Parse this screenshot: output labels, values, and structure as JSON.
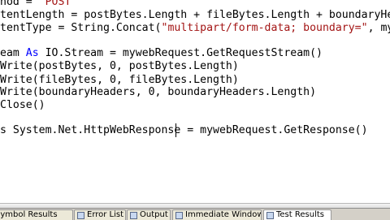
{
  "editor": {
    "lines": [
      [
        {
          "t": "hod = ",
          "c": "txt"
        },
        {
          "t": "\"POST\"",
          "c": "str"
        }
      ],
      [
        {
          "t": "tentLength = postBytes.Length + fileBytes.Length + boundaryHeaders.Le",
          "c": "txt"
        }
      ],
      [
        {
          "t": "tentType = String.Concat(",
          "c": "txt"
        },
        {
          "t": "\"multipart/form-data; boundary=\"",
          "c": "str"
        },
        {
          "t": ", myboundary",
          "c": "txt"
        }
      ],
      [
        {
          "t": "",
          "c": "txt"
        }
      ],
      [
        {
          "t": "eam ",
          "c": "txt"
        },
        {
          "t": "As",
          "c": "kw"
        },
        {
          "t": " IO.Stream = mywebRequest.GetRequestStream()",
          "c": "txt"
        }
      ],
      [
        {
          "t": "Write(postBytes, 0, postBytes.Length)",
          "c": "txt"
        }
      ],
      [
        {
          "t": "Write(fileBytes, 0, fileBytes.Length)",
          "c": "txt"
        }
      ],
      [
        {
          "t": "Write(boundaryHeaders, 0, boundaryHeaders.Length)",
          "c": "txt"
        }
      ],
      [
        {
          "t": "Close()",
          "c": "txt"
        }
      ],
      [
        {
          "t": "",
          "c": "txt"
        }
      ],
      [
        {
          "t": "s System.Net.HttpWebResponse = mywebRequest.GetResponse()",
          "c": "txt"
        }
      ]
    ]
  },
  "bottom_tabs": [
    {
      "label": "Symbol Results",
      "icon": "symbol-results-icon",
      "active": false
    },
    {
      "label": "Error List",
      "icon": "error-list-icon",
      "active": false
    },
    {
      "label": "Output",
      "icon": "output-icon",
      "active": false
    },
    {
      "label": "Immediate Window",
      "icon": "immediate-window-icon",
      "active": false
    },
    {
      "label": "Test Results",
      "icon": "test-results-icon",
      "active": true
    }
  ],
  "colors": {
    "keyword": "#0000ff",
    "string": "#a31515",
    "text": "#000000",
    "tab_bar": "#d4d0c8"
  }
}
